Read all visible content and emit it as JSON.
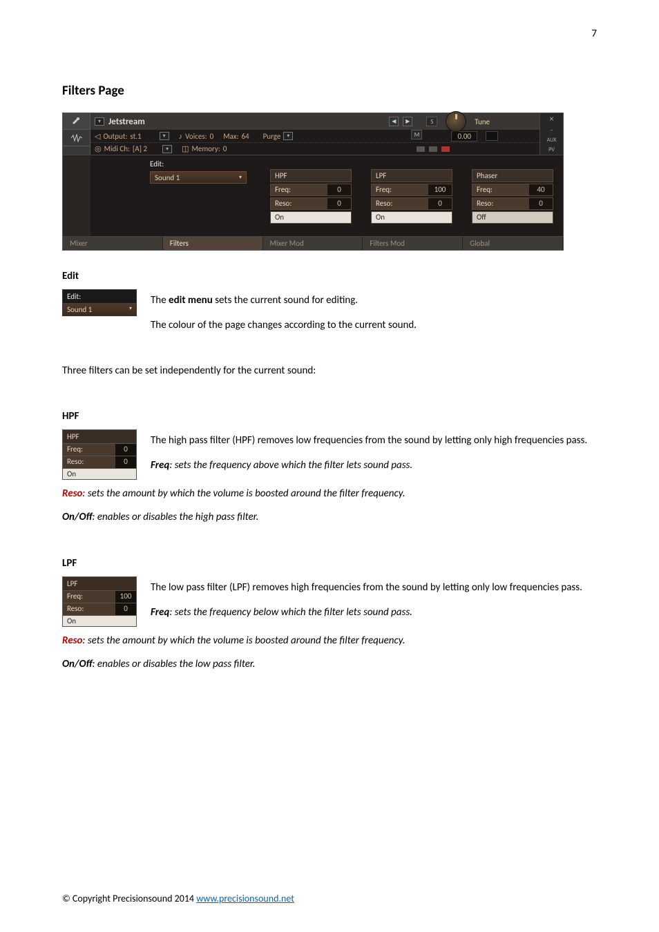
{
  "pageNumber": "7",
  "sectionTitle": "Filters Page",
  "topPanel": {
    "instrumentName": "Jetstream",
    "outputLabel": "Output:",
    "outputValue": "st.1",
    "midiLabel": "Midi Ch:",
    "midiValue": "[A]  2",
    "voicesLabel": "Voices:",
    "voicesValue": "0",
    "maxLabel": "Max:",
    "maxValue": "64",
    "memoryLabel": "Memory:",
    "memoryValue": "0",
    "purgeLabel": "Purge",
    "tuneLabel": "Tune",
    "tuneValue": "0.00",
    "sBtn": "S",
    "mBtn": "M",
    "auxLabel": "AUX",
    "pvLabel": "PV",
    "closeIcon": "×",
    "minIcon": "–"
  },
  "editSection": {
    "label": "Edit:",
    "soundName": "Sound 1",
    "columnSound": "Sound 1"
  },
  "filters": {
    "hpf": {
      "title": "HPF",
      "freqLabel": "Freq:",
      "freqValue": "0",
      "resoLabel": "Reso:",
      "resoValue": "0",
      "state": "On"
    },
    "lpf": {
      "title": "LPF",
      "freqLabel": "Freq:",
      "freqValue": "100",
      "resoLabel": "Reso:",
      "resoValue": "0",
      "state": "On"
    },
    "phaser": {
      "title": "Phaser",
      "freqLabel": "Freq:",
      "freqValue": "40",
      "resoLabel": "Reso:",
      "resoValue": "0",
      "state": "Off"
    }
  },
  "tabs": [
    "Mixer",
    "Filters",
    "Mixer Mod",
    "Filters Mod",
    "Global"
  ],
  "activeTab": 1,
  "headings": {
    "edit": "Edit",
    "hpf": "HPF",
    "lpf": "LPF"
  },
  "body": {
    "editMain": "The ",
    "editBold": "edit menu",
    "editRest": " sets the current sound for editing.",
    "editColour": "The colour of the page changes according to the current sound.",
    "threeFilters": "Three filters can be set independently for the current sound:",
    "hpfIntro": "The high pass filter (HPF) removes low frequencies from the sound by letting only high frequencies pass.",
    "freqLabel": "Freq",
    "hpfFreq": ": sets the frequency above which the filter lets sound pass.",
    "resoLabel": "Reso",
    "resoText": ": sets the amount by which the volume is boosted around the filter frequency.",
    "onoffLabel": "On/Off",
    "hpfOnOff": ": enables or disables the high pass filter.",
    "lpfIntro": "The low pass filter (LPF) removes high frequencies from the sound by letting only low frequencies pass.",
    "lpfFreq": ": sets the frequency below which the filter lets sound pass.",
    "lpfOnOff": ": enables or disables the low pass filter."
  },
  "miniEdit": {
    "title": "Edit:",
    "value": "Sound 1"
  },
  "miniHPF": {
    "title": "HPF",
    "freqLabel": "Freq:",
    "freqValue": "0",
    "resoLabel": "Reso:",
    "resoValue": "0",
    "state": "On"
  },
  "miniLPF": {
    "title": "LPF",
    "freqLabel": "Freq:",
    "freqValue": "100",
    "resoLabel": "Reso:",
    "resoValue": "0",
    "state": "On"
  },
  "footer": {
    "text": "© Copyright Precisionsound 2014 ",
    "linkText": "www.precisionsound.net"
  }
}
